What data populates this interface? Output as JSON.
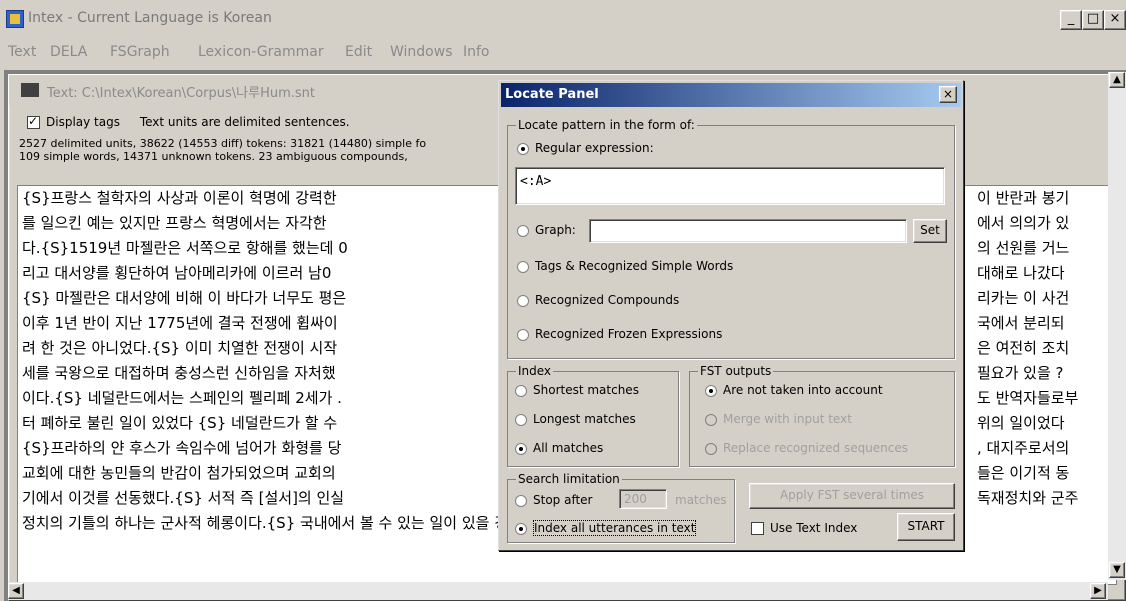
{
  "app": {
    "title": "Intex - Current Language is Korean"
  },
  "menu": [
    "Text",
    "DELA",
    "FSGraph",
    "Lexicon-Grammar",
    "Edit",
    "Windows",
    "Info"
  ],
  "text_window": {
    "title": "Text: C:\\Intex\\Korean\\Corpus\\나루Hum.snt",
    "display_tags": "Display tags",
    "units_info": "Text units are delimited sentences.",
    "stats_line1": "2527 delimited units, 38622 (14553 diff) tokens: 31821 (14480) simple fo",
    "stats_line2": "109 simple words, 14371 unknown tokens. 23 ambiguous compounds,",
    "lines_left": [
      "{S}프랑스 철학자의 사상과 이론이 혁명에 강력한",
      "를 일으킨 예는 있지만 프랑스 혁명에서는 자각한",
      "다.{S}1519년 마젤란은 서쪽으로 항해를 했는데 0",
      "리고 대서양를 횡단하여 남아메리카에 이르러 남0",
      "{S} 마젤란은 대서양에 비해 이 바다가 너무도 평은",
      "이후 1년 반이 지난 1775년에 결국 전쟁에 휩싸이",
      "려 한 것은 아니었다.{S} 이미 치열한 전쟁이 시작",
      "세를 국왕으로 대접하며 충성스런 신하임을 자처했",
      "이다.{S} 네덜란드에서는 스페인의 펠리페 2세가 .",
      "터 폐하로 불린 일이 있었다 {S} 네덜란드가 할 수",
      "{S}프라하의 얀 후스가 속임수에 넘어가 화형를 당",
      "교회에 대한 농민들의 반감이 첨가되었으며 교회의",
      "기에서 이것를 선동했다.{S} 서적 즉 [설서]의 인실",
      "정치의 기틀의 하나는 군사적 헤롱이다.{S} 국내에서 볼 수 있는 일이 있을 경우 국왕과 정부는 오히 국민의 관심을"
    ],
    "lines_right": [
      "이 반란과 봉기",
      "에서 의의가 있",
      "의 선원를 거느",
      "대해로 나갔다",
      "리카는 이 사건",
      "국에서 분리되",
      "은 여전히 조치",
      "필요가 있을 ?",
      "도 반역자들로부",
      "위의 일이었다",
      ", 대지주로서의",
      "들은 이기적 동",
      "독재정치와 군주",
      ""
    ]
  },
  "locate_panel": {
    "title": "Locate Panel",
    "pattern_group": "Locate pattern in the form of:",
    "regex_label": "Regular expression:",
    "regex_value": "<:A>",
    "graph_label": "Graph:",
    "graph_value": "",
    "set_button": "Set",
    "opt_tags": "Tags & Recognized Simple Words",
    "opt_compounds": "Recognized Compounds",
    "opt_frozen": "Recognized Frozen Expressions",
    "index_group": "Index",
    "index_shortest": "Shortest matches",
    "index_longest": "Longest matches",
    "index_all": "All matches",
    "fst_group": "FST outputs",
    "fst_not_taken": "Are not taken into account",
    "fst_merge": "Merge with input text",
    "fst_replace": "Replace recognized sequences",
    "search_group": "Search limitation",
    "stop_after": "Stop after",
    "stop_value": "200",
    "matches": "matches",
    "index_all_utt": "Index all utterances in text",
    "apply_fst": "Apply FST several times",
    "use_text_index": "Use Text Index",
    "start": "START"
  }
}
